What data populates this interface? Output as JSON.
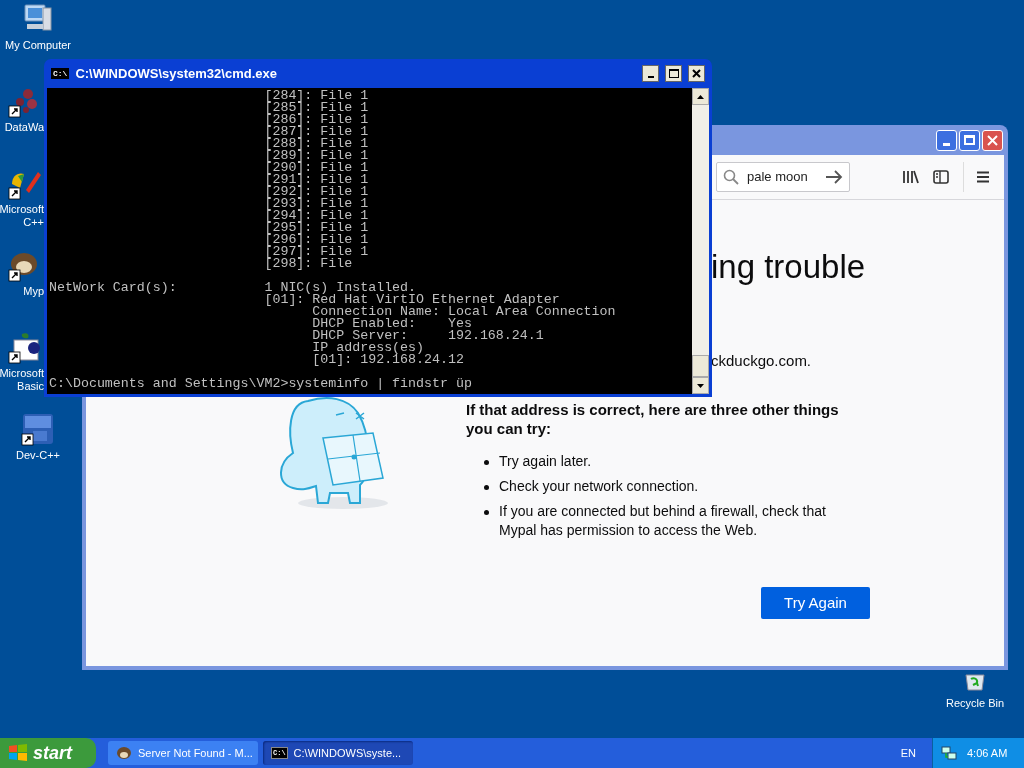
{
  "desktop_icons": [
    {
      "label": "My Computer",
      "kind": "computer",
      "cut": false
    },
    {
      "label": "DataWa",
      "kind": "dots",
      "cut": true
    },
    {
      "label": "Microsoft C++",
      "kind": "tools",
      "cut": true
    },
    {
      "label": "Myp",
      "kind": "creature",
      "cut": true
    },
    {
      "label": "Microsoft Basic",
      "kind": "basic",
      "cut": true
    },
    {
      "label": "Dev-C++",
      "kind": "dev",
      "cut": false
    }
  ],
  "recycle_bin": {
    "label": "Recycle Bin"
  },
  "browser": {
    "search": {
      "value": "pale moon"
    },
    "heading": "ing trouble",
    "address_text": "ckduckgo.com.",
    "suggestions_title": "If that address is correct, here are three other things you can try:",
    "suggestions": [
      "Try again later.",
      "Check your network connection.",
      "If you are connected but behind a firewall, check that Mypal has permission to access the Web."
    ],
    "button": "Try Again"
  },
  "console": {
    "title": "C:\\WINDOWS\\system32\\cmd.exe",
    "icon_text": "C:\\",
    "blocks": [
      [
        "                           [284]: File 1",
        "                           [285]: File 1",
        "                           [286]: File 1",
        "                           [287]: File 1",
        "                           [288]: File 1",
        "                           [289]: File 1",
        "                           [290]: File 1",
        "                           [291]: File 1",
        "                           [292]: File 1",
        "                           [293]: File 1",
        "                           [294]: File 1",
        "                           [295]: File 1",
        "                           [296]: File 1",
        "                           [297]: File 1",
        "                           [298]: File"
      ],
      [
        "NetWork Card(s):           1 NIC(s) Installed.",
        "                           [01]: Red Hat VirtIO Ethernet Adapter",
        "                                 Connection Name: Local Area Connection",
        "                                 DHCP Enabled:    Yes",
        "                                 DHCP Server:     192.168.24.1",
        "                                 IP address(es)",
        "                                 [01]: 192.168.24.12"
      ],
      [
        "C:\\Documents and Settings\\VM2>systeminfo | findstr üp"
      ]
    ]
  },
  "taskbar": {
    "start": "start",
    "tasks": [
      {
        "label": "Server Not Found - M...",
        "kind": "browser",
        "selected": false
      },
      {
        "label": "C:\\WINDOWS\\syste...",
        "kind": "console",
        "selected": true,
        "icon_text": "C:\\"
      }
    ],
    "language": "EN",
    "clock": "4:06 AM"
  }
}
